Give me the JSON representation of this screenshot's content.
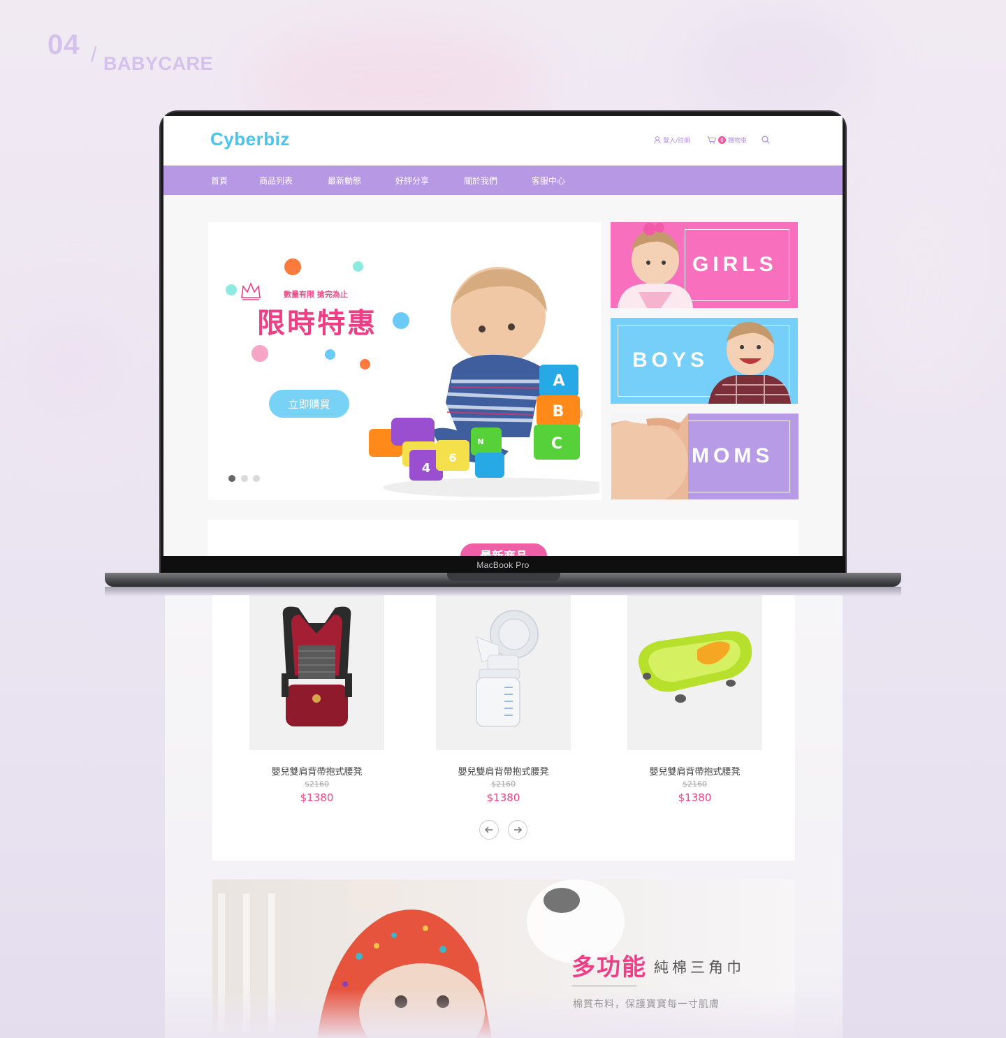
{
  "showcase": {
    "number": "04",
    "slash": "/",
    "title": "BABYCARE"
  },
  "device_label": "MacBook Pro",
  "header": {
    "logo": "Cyberbiz",
    "login": "登入/註冊",
    "cart_count": "0",
    "cart": "購物車"
  },
  "nav": [
    {
      "label": "首頁"
    },
    {
      "label": "商品列表"
    },
    {
      "label": "最新動態"
    },
    {
      "label": "好評分享"
    },
    {
      "label": "關於我們"
    },
    {
      "label": "客服中心"
    }
  ],
  "hero": {
    "tagline": "數量有限 搶完為止",
    "headline": "限時特惠",
    "cta": "立即購買",
    "slides": 3,
    "active_slide": 1,
    "toy_letters": [
      "A",
      "B",
      "C",
      "4",
      "6",
      "N"
    ]
  },
  "categories": [
    {
      "label": "GIRLS",
      "color": "#f76fbd"
    },
    {
      "label": "BOYS",
      "color": "#76cff8"
    },
    {
      "label": "MOMS",
      "color": "#b79be6"
    }
  ],
  "latest": {
    "badge": "最新商品"
  },
  "products": [
    {
      "name": "嬰兒雙肩背帶抱式腰凳",
      "old_price": "$2160",
      "price": "$1380"
    },
    {
      "name": "嬰兒雙肩背帶抱式腰凳",
      "old_price": "$2160",
      "price": "$1380"
    },
    {
      "name": "嬰兒雙肩背帶抱式腰凳",
      "old_price": "$2160",
      "price": "$1380"
    }
  ],
  "promo": {
    "title_bold": "多功能",
    "title_light": "純棉三角巾",
    "subtitle": "棉質布料，保護寶寶每一寸肌膚"
  },
  "colors": {
    "accent_pink": "#ee3f86",
    "nav_purple": "#b798e4",
    "logo_blue": "#49c4ee"
  }
}
